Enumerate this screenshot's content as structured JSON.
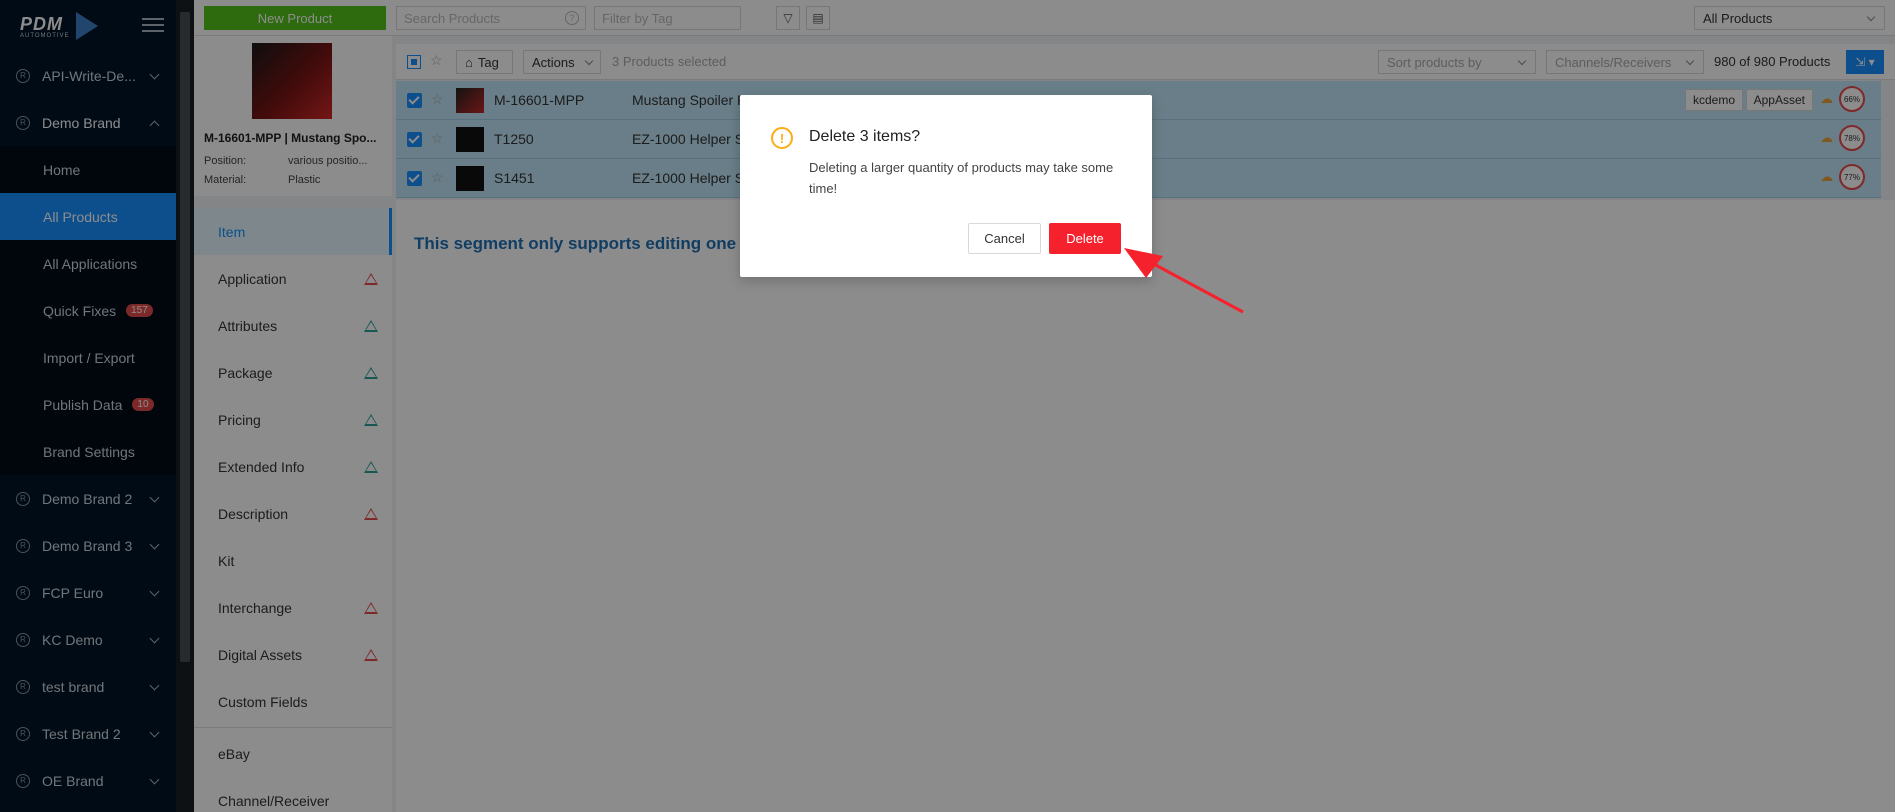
{
  "brand": {
    "logo_text": "PDM",
    "logo_sub": "AUTOMOTIVE"
  },
  "nav": {
    "groups_top": [
      {
        "label": "API-Write-De..."
      }
    ],
    "active_group": {
      "label": "Demo Brand"
    },
    "items": [
      {
        "label": "Home"
      },
      {
        "label": "All Products"
      },
      {
        "label": "All Applications"
      },
      {
        "label": "Quick Fixes",
        "badge": "157"
      },
      {
        "label": "Import / Export"
      },
      {
        "label": "Publish Data",
        "badge": "10"
      },
      {
        "label": "Brand Settings"
      }
    ],
    "groups_bottom": [
      {
        "label": "Demo Brand 2"
      },
      {
        "label": "Demo Brand 3"
      },
      {
        "label": "FCP Euro"
      },
      {
        "label": "KC Demo"
      },
      {
        "label": "test brand"
      },
      {
        "label": "Test Brand 2"
      },
      {
        "label": "OE Brand"
      }
    ]
  },
  "topbar": {
    "new_product": "New Product",
    "search_placeholder": "Search Products",
    "tag_placeholder": "Filter by Tag",
    "view_select": "All Products"
  },
  "preview": {
    "title": "M-16601-MPP | Mustang Spo...",
    "fields": [
      {
        "k": "Position:",
        "v": "various positio..."
      },
      {
        "k": "Material:",
        "v": "Plastic"
      }
    ]
  },
  "segments": [
    {
      "label": "Item",
      "warn": ""
    },
    {
      "label": "Application",
      "warn": "red"
    },
    {
      "label": "Attributes",
      "warn": "teal"
    },
    {
      "label": "Package",
      "warn": "teal"
    },
    {
      "label": "Pricing",
      "warn": "teal"
    },
    {
      "label": "Extended Info",
      "warn": "teal"
    },
    {
      "label": "Description",
      "warn": "red"
    },
    {
      "label": "Kit",
      "warn": ""
    },
    {
      "label": "Interchange",
      "warn": "red"
    },
    {
      "label": "Digital Assets",
      "warn": "red"
    },
    {
      "label": "Custom Fields",
      "warn": ""
    },
    {
      "label": "eBay",
      "warn": ""
    },
    {
      "label": "Channel/Receiver",
      "warn": ""
    }
  ],
  "list_toolbar": {
    "tag": "Tag",
    "actions": "Actions",
    "selected": "3 Products selected",
    "sort": "Sort products by",
    "channels": "Channels/Receivers",
    "count": "980 of 980 Products"
  },
  "rows": [
    {
      "pn": "M-16601-MPP",
      "desc": "Mustang Spoiler F",
      "tags": [
        "kcdemo",
        "AppAsset"
      ],
      "score": "66%"
    },
    {
      "pn": "T1250",
      "desc": "EZ-1000 Helper Sp",
      "tags": [],
      "score": "78%"
    },
    {
      "pn": "S1451",
      "desc": "EZ-1000 Helper Sp",
      "tags": [],
      "score": "77%"
    }
  ],
  "main": {
    "segment_msg": "This segment only supports editing one p"
  },
  "modal": {
    "title": "Delete 3 items?",
    "body": "Deleting a larger quantity of products may take some time!",
    "cancel": "Cancel",
    "delete": "Delete"
  },
  "colors": {
    "accent": "#1890ff",
    "danger": "#f5222d",
    "new_button": "#52c41a",
    "nav_bg": "#001529"
  }
}
